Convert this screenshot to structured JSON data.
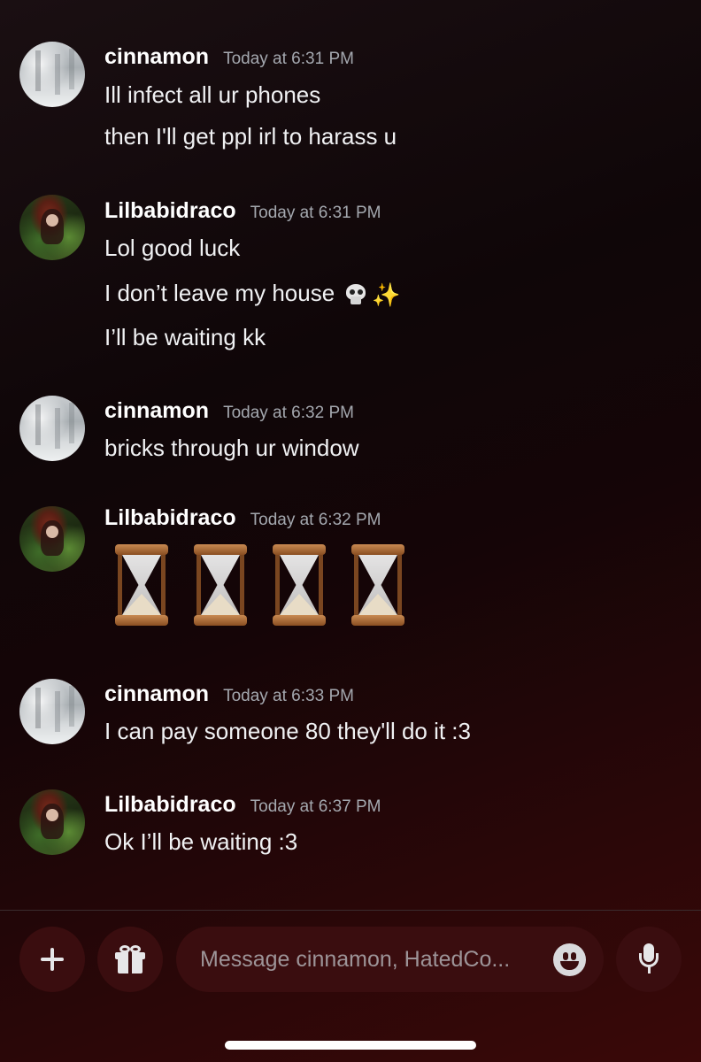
{
  "messages": [
    {
      "author": "cinnamon",
      "timestamp": "Today at 6:31 PM",
      "avatar": "snowy-forest-avatar",
      "lines": [
        "Ill infect all ur phones",
        "then I'll get ppl irl to harass u"
      ]
    },
    {
      "author": "Lilbabidraco",
      "timestamp": "Today at 6:31 PM",
      "avatar": "red-haired-forest-avatar",
      "lines": [
        "Lol good luck",
        "I don’t leave my house",
        "I’ll be waiting kk"
      ],
      "emojis_line_2": [
        "skull-emoji",
        "sparkles-emoji"
      ]
    },
    {
      "author": "cinnamon",
      "timestamp": "Today at 6:32 PM",
      "avatar": "snowy-forest-avatar",
      "lines": [
        "bricks through ur window"
      ]
    },
    {
      "author": "Lilbabidraco",
      "timestamp": "Today at 6:32 PM",
      "avatar": "red-haired-forest-avatar",
      "emoji_only": [
        "hourglass-emoji",
        "hourglass-emoji",
        "hourglass-emoji",
        "hourglass-emoji"
      ]
    },
    {
      "author": "cinnamon",
      "timestamp": "Today at 6:33 PM",
      "avatar": "snowy-forest-avatar",
      "lines": [
        "I can pay someone 80 they'll do it :3"
      ]
    },
    {
      "author": "Lilbabidraco",
      "timestamp": "Today at 6:37 PM",
      "avatar": "red-haired-forest-avatar",
      "lines": [
        "Ok I’ll be waiting :3"
      ]
    }
  ],
  "composer": {
    "placeholder": "Message cinnamon, HatedCo...",
    "buttons": [
      "plus-icon",
      "gift-icon",
      "emoji-icon",
      "microphone-icon"
    ]
  },
  "colors": {
    "background_dark": "#0f0608",
    "background_red": "#3a0808",
    "button_bg": "#3a0d0f",
    "timestamp": "#a4a8af",
    "text": "#f0f1f3"
  }
}
